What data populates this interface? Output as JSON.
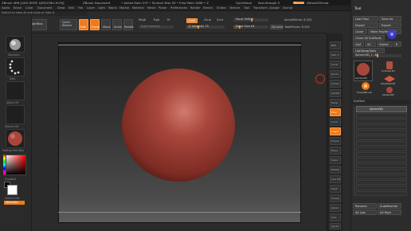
{
  "title_bar": {
    "app_title": "ZBrush 4R8 [QXG-SHGF-QDFJ-FJNU-HCHJ]",
    "document": "ZBrush Document",
    "stats": "• Active Mem 297 • Scratch Disk 55 • Free Mem 1898 • Z",
    "quicksave": "QuickSave",
    "seethrough": "See-through 0",
    "menus_btn": "Menus",
    "script": "DefaultZScript"
  },
  "menu_bar": {
    "items": [
      "Alpha",
      "Brush",
      "Color",
      "Document",
      "Draw",
      "Edit",
      "File",
      "Layer",
      "Light",
      "Macro",
      "Marker",
      "Material",
      "Movie",
      "Picker",
      "Preferences",
      "Render",
      "Stencil",
      "Stroke",
      "Texture",
      "Tool",
      "Transform",
      "Zplugin",
      "Zscript"
    ]
  },
  "tip": "Switch to view all sub tools or hide it",
  "top_shelf": {
    "projection_master": "Projection Master",
    "lightbox": "LightBox",
    "quick_sketch": "Quick Sketch",
    "edit": "Edit",
    "draw": "Draw",
    "move": "Move",
    "scale": "Scale",
    "rotate": "Rotate",
    "mrgb": "Mrgb",
    "rgb": "Rgb",
    "m": "M",
    "zadd": "Zadd",
    "zsub": "Zsub",
    "zcut": "Zcut",
    "z_intensity": "Z Intensity 25",
    "rgb_intensity": "Rgb Intensity",
    "focal_shift": "Focal Shift 0",
    "draw_size": "Draw Size 64",
    "dynamic": "Dynamic",
    "active_points": "ActivePoints: 8,320",
    "total_points": "TotalPoints: 8,320"
  },
  "left_panel": {
    "labels": [
      "Standard",
      "Dots",
      "Alpha Off",
      "Texture Off",
      "MatCap Red Wax",
      "Gradient",
      "SwitchColor",
      "Alternate"
    ]
  },
  "right_column": {
    "labels": [
      "BPR",
      "SPix 3",
      "Scroll",
      "Zoom",
      "Actual",
      "AAHalf",
      "Persp",
      "Floor",
      "Local",
      "L.Sym",
      "Frame",
      "Move",
      "Scale",
      "Rotate",
      "Line Fill",
      "PolyF",
      "Transp",
      "Ghost",
      "Solo",
      "Xpose"
    ]
  },
  "tool_panel": {
    "header": "Tool",
    "load_tool": "Load Tool",
    "save_as": "Save As",
    "import": "Import",
    "export": "Export",
    "clone": "Clone",
    "make_polymesh": "Make PolyMesh3D",
    "clone_all": "Clone All SubTools",
    "goz": "GoZ",
    "all": "All",
    "visible": "Visible",
    "r": "R",
    "lightbox_tools": "Lightbox▸Tools",
    "sphere_slider": "Sphere3D_1. 48",
    "tool_names": [
      "Sphere3D",
      "Cylinder3D",
      "PolyMesh3D",
      "SimpleBrush",
      "Sphere3D"
    ],
    "subtool_header": "SubTool",
    "subtool_item": "Sphere3D",
    "rename": "Rename",
    "autoreorder": "AutoReorder",
    "all_low": "All Low",
    "all_high": "All High"
  },
  "colors": {
    "accent": "#ef7a1a",
    "sphere": "#a6463b",
    "background": "#2b2b2b"
  }
}
